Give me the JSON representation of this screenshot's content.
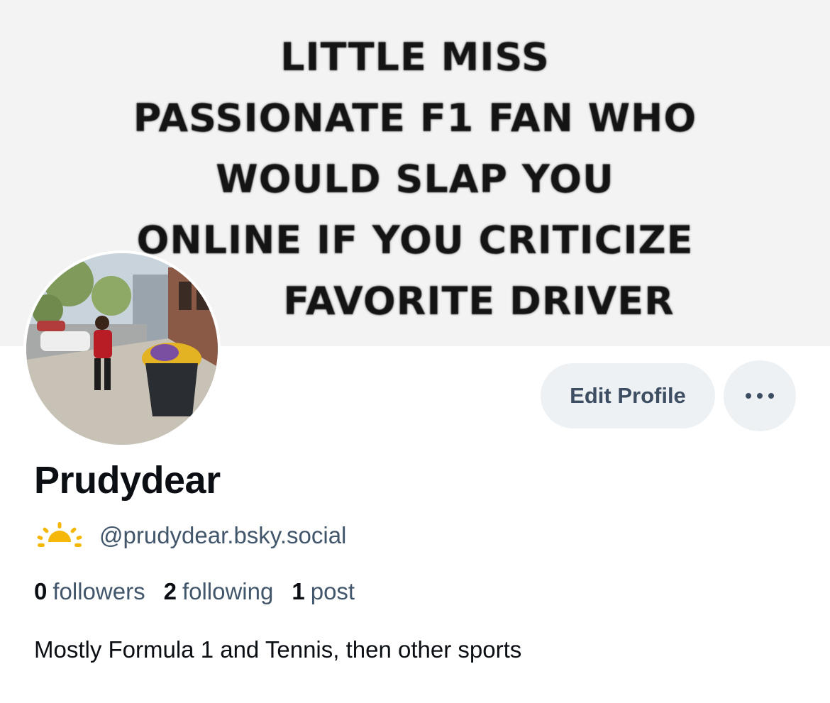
{
  "banner": {
    "lines": [
      "LITTLE MISS",
      "PASSIONATE F1 FAN WHO",
      "WOULD SLAP YOU",
      "ONLINE IF YOU CRITICIZE",
      "FAVORITE DRIVER"
    ]
  },
  "profile": {
    "display_name": "Prudydear",
    "handle": "@prudydear.bsky.social",
    "handle_icon": "sun-icon",
    "bio": "Mostly Formula 1 and Tennis, then other sports"
  },
  "actions": {
    "edit_label": "Edit Profile",
    "more_icon": "more-dots-icon"
  },
  "stats": {
    "followers_count": "0",
    "followers_label": "followers",
    "following_count": "2",
    "following_label": "following",
    "posts_count": "1",
    "posts_label": "post"
  },
  "colors": {
    "button_bg": "#eef1f4",
    "button_text": "#3d4e63",
    "secondary_text": "#42566b",
    "primary_text": "#0b0f14",
    "sun_yellow": "#f5b80a"
  }
}
